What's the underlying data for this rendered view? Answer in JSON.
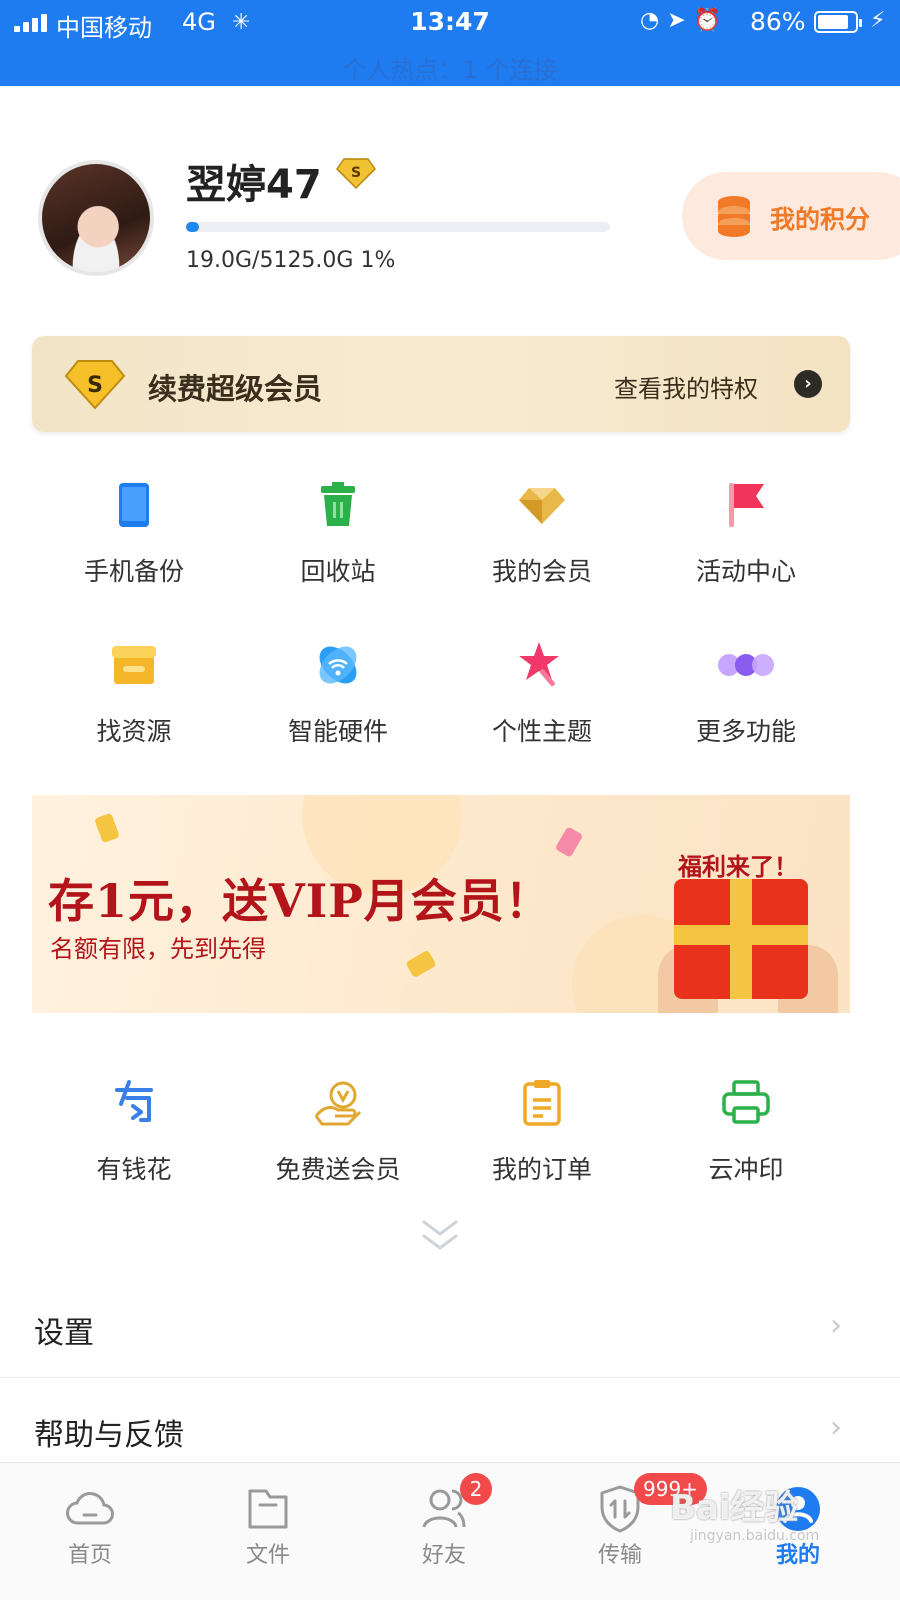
{
  "status_bar": {
    "carrier": "中国移动",
    "network": "4G",
    "time": "13:47",
    "battery": "86%",
    "battery_level": 0.86,
    "hotspot": "个人热点：1 个连接"
  },
  "profile": {
    "username": "翌婷47",
    "storage_text": "19.0G/5125.0G 1%",
    "storage_fraction": 0.03,
    "points_label": "我的积分"
  },
  "vip": {
    "title": "续费超级会员",
    "link": "查看我的特权"
  },
  "grid": [
    {
      "label": "手机备份",
      "icon": "phone-icon",
      "color": "#1e7cf0"
    },
    {
      "label": "回收站",
      "icon": "trash-icon",
      "color": "#2cb04a"
    },
    {
      "label": "我的会员",
      "icon": "diamond-icon",
      "color": "#e0b040"
    },
    {
      "label": "活动中心",
      "icon": "flag-icon",
      "color": "#f0355a"
    },
    {
      "label": "找资源",
      "icon": "store-icon",
      "color": "#f5b62a"
    },
    {
      "label": "智能硬件",
      "icon": "wifi-icon",
      "color": "#2a9df4"
    },
    {
      "label": "个性主题",
      "icon": "star-wand-icon",
      "color": "#f0386a"
    },
    {
      "label": "更多功能",
      "icon": "more-dots-icon",
      "color": "#8a5cf0"
    }
  ],
  "promo": {
    "title": "存1元，送VIP月会员！",
    "subtitle": "名额有限，先到先得",
    "tag": "福利来了！"
  },
  "services": [
    {
      "label": "有钱花",
      "icon": "money-icon",
      "color": "#3a7ee8"
    },
    {
      "label": "免费送会员",
      "icon": "hand-coin-icon",
      "color": "#e0a830"
    },
    {
      "label": "我的订单",
      "icon": "clipboard-icon",
      "color": "#f0a828"
    },
    {
      "label": "云冲印",
      "icon": "printer-icon",
      "color": "#2cb04a"
    }
  ],
  "list": [
    {
      "label": "设置"
    },
    {
      "label": "帮助与反馈"
    }
  ],
  "tabs": [
    {
      "label": "首页",
      "icon": "cloud-icon"
    },
    {
      "label": "文件",
      "icon": "folder-icon"
    },
    {
      "label": "好友",
      "icon": "friends-icon",
      "badge": "2"
    },
    {
      "label": "传输",
      "icon": "transfer-icon",
      "badge": "999+"
    },
    {
      "label": "我的",
      "icon": "me-icon",
      "active": true
    }
  ],
  "watermark": {
    "text": "Bai经验",
    "url": "jingyan.baidu.com"
  }
}
